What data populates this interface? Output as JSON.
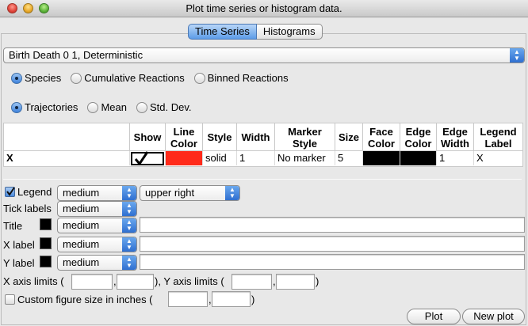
{
  "window": {
    "title": "Plot time series or histogram data."
  },
  "tabs": [
    {
      "label": "Time Series",
      "active": true
    },
    {
      "label": "Histograms",
      "active": false
    }
  ],
  "model_select": {
    "value": "Birth Death 0 1, Deterministic"
  },
  "data_type": {
    "options": [
      "Species",
      "Cumulative Reactions",
      "Binned Reactions"
    ],
    "selected": "Species"
  },
  "stat_type": {
    "options": [
      "Trajectories",
      "Mean",
      "Std. Dev."
    ],
    "selected": "Trajectories"
  },
  "table": {
    "headers": [
      "Show",
      "Line Color",
      "Style",
      "Width",
      "Marker Style",
      "Size",
      "Face Color",
      "Edge Color",
      "Edge Width",
      "Legend Label"
    ],
    "rows": [
      {
        "name": "X",
        "show": true,
        "line_color": "#ff2a1a",
        "style": "solid",
        "width": "1",
        "marker_style": "No marker",
        "size": "5",
        "face_color": "#000000",
        "edge_color": "#000000",
        "edge_width": "1",
        "legend_label": "X"
      }
    ]
  },
  "legend": {
    "label": "Legend",
    "checked": true,
    "size": "medium",
    "location": "upper right"
  },
  "tick_labels": {
    "label": "Tick labels",
    "size": "medium"
  },
  "title": {
    "label": "Title",
    "size": "medium",
    "color": "#000000",
    "value": ""
  },
  "x_label": {
    "label": "X label",
    "size": "medium",
    "color": "#000000",
    "value": ""
  },
  "y_label": {
    "label": "Y label",
    "size": "medium",
    "color": "#000000",
    "value": ""
  },
  "axis_limits": {
    "x_label": "X axis limits (",
    "sep": ",",
    "mid": "), Y axis limits (",
    "end": ")"
  },
  "custom_size": {
    "label": "Custom figure size in inches (",
    "sep": ",",
    "end": ")",
    "checked": false
  },
  "buttons": {
    "plot": "Plot",
    "new_plot": "New plot"
  },
  "colors": {
    "accent": "#3f83dc",
    "line_red": "#ff2a1a"
  }
}
